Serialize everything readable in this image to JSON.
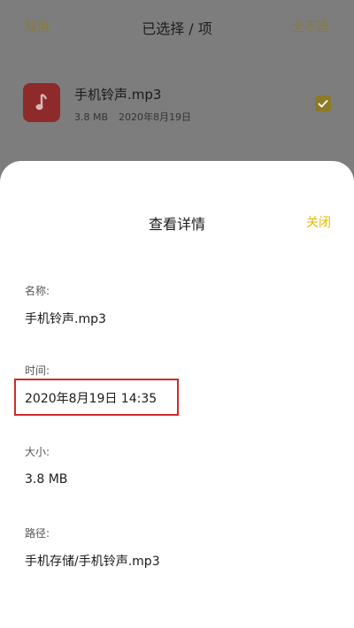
{
  "top_bar": {
    "cancel_label": "取消",
    "title": "已选择 / 项",
    "deselect_label": "全不选"
  },
  "file": {
    "name": "手机铃声.mp3",
    "size": "3.8 MB",
    "date": "2020年8月19日"
  },
  "sheet": {
    "title": "查看详情",
    "close_label": "关闭",
    "fields": [
      {
        "label": "名称:",
        "value": "手机铃声.mp3"
      },
      {
        "label": "时间:",
        "value": "2020年8月19日 14:35"
      },
      {
        "label": "大小:",
        "value": "3.8 MB"
      },
      {
        "label": "路径:",
        "value": "手机存储/手机铃声.mp3"
      }
    ]
  },
  "colors": {
    "accent": "#e6b800",
    "file_icon_bg": "#c0392b",
    "highlight": "#d02b2b"
  },
  "icons": {
    "file_icon": "music-note-icon",
    "checkbox": "checkmark-icon"
  }
}
